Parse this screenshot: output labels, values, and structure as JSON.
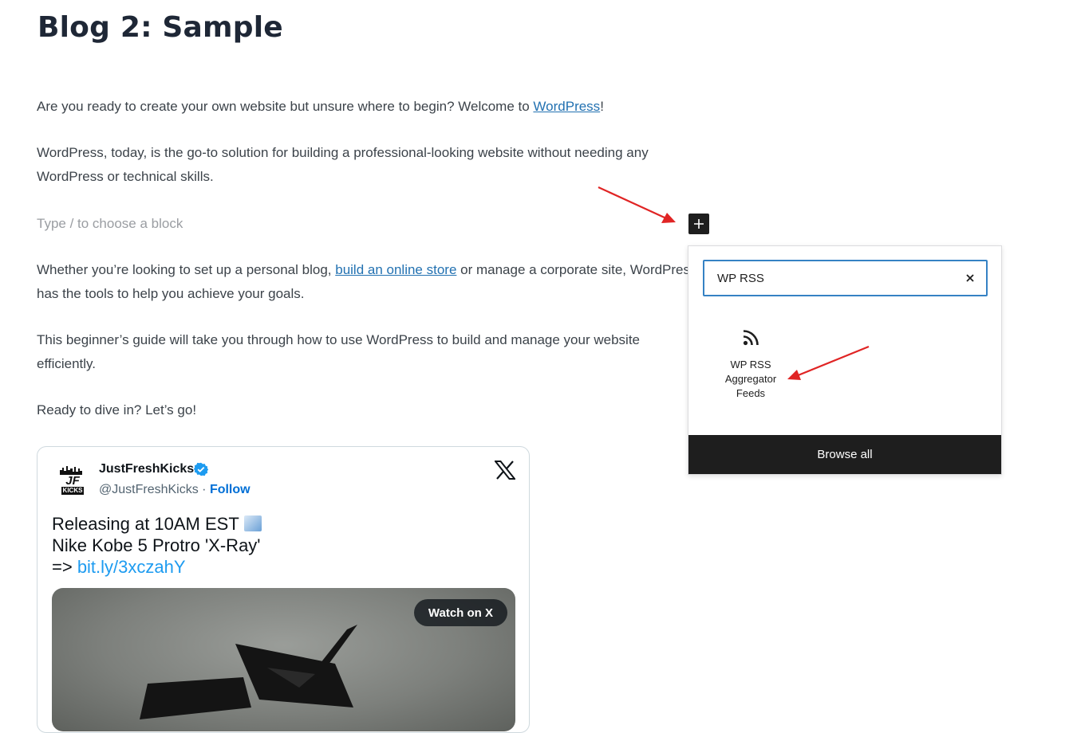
{
  "post": {
    "title": "Blog 2: Sample",
    "p1_text": "Are you ready to create your own website but unsure where to begin? Welcome to ",
    "p1_link": "WordPress",
    "p1_end": "!",
    "p2_text": "WordPress, today, is the go-to solution for building a professional-looking website without needing any WordPress or technical skills.",
    "placeholder": "Type / to choose a block",
    "p3_start": "Whether you’re looking to set up a personal blog, ",
    "p3_link": "build an online store",
    "p3_end": " or manage a corporate site, WordPress has the tools to help you achieve your goals.",
    "p4_text": "This beginner’s guide will take you through how to use WordPress to build and manage your website efficiently.",
    "p5_text": "Ready to dive in? Let’s go!"
  },
  "inserter": {
    "toggle_icon": "plus-icon",
    "search_value": "WP RSS",
    "clear_icon": "close-icon",
    "result": {
      "icon": "rss-icon",
      "label": "WP RSS Aggregator Feeds"
    },
    "browse_all": "Browse all"
  },
  "tweet": {
    "author_name": "JustFreshKicks",
    "handle": "@JustFreshKicks",
    "separator": " · ",
    "follow": "Follow",
    "line1": "Releasing at 10AM EST",
    "line2": "Nike Kobe 5 Protro 'X-Ray'",
    "line3_prefix": "=> ",
    "line3_link": "bit.ly/3xczahY",
    "watch_button": "Watch on X",
    "avatar_text_top": "JF",
    "avatar_text_bottom": "KICKS"
  },
  "colors": {
    "link": "#2271b1",
    "accent": "#3582c4",
    "dark": "#1e1e1e",
    "annotation_arrow": "#e02424"
  }
}
